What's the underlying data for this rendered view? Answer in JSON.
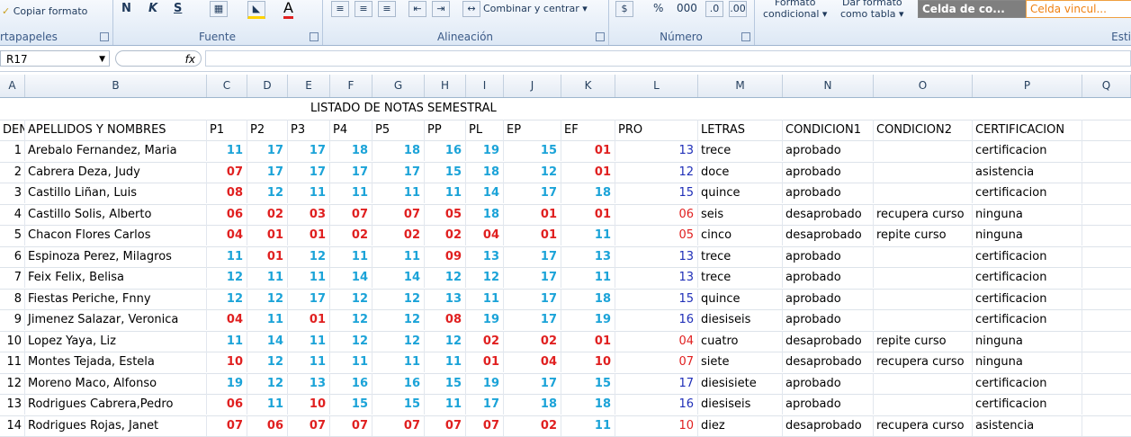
{
  "ribbon": {
    "copy_format": "Copiar formato",
    "groups": {
      "clipboard": "rtapapeles",
      "font": "Fuente",
      "alignment": "Alineación",
      "number": "Número",
      "styles": "Esti"
    },
    "font_buttons": {
      "bold": "N",
      "italic": "K",
      "underline": "S"
    },
    "merge_center": "Combinar y centrar",
    "number_buttons": {
      "percent": "%",
      "thousands": "000"
    },
    "conditional_format": [
      "Formato",
      "condicional"
    ],
    "table_format": [
      "Dar formato",
      "como tabla"
    ],
    "cell_style_1": "Celda de co...",
    "cell_style_2": "Celda vincul..."
  },
  "formula_bar": {
    "name_box": "R17",
    "fx": "fx",
    "value": ""
  },
  "column_headers": [
    "A",
    "B",
    "C",
    "D",
    "E",
    "F",
    "G",
    "H",
    "I",
    "J",
    "K",
    "L",
    "M",
    "N",
    "O",
    "P",
    "Q"
  ],
  "sheet": {
    "title": "LISTADO DE NOTAS SEMESTRAL",
    "headers": [
      "DEN",
      "APELLIDOS Y NOMBRES",
      "P1",
      "P2",
      "P3",
      "P4",
      "P5",
      "PP",
      "PL",
      "EP",
      "EF",
      "PRO",
      "LETRAS",
      "CONDICION1",
      "CONDICION2",
      "CERTIFICACION"
    ],
    "rows": [
      {
        "n": "1",
        "name": "Arebalo Fernandez, Maria",
        "g": [
          "11",
          "17",
          "17",
          "18",
          "18",
          "16",
          "19",
          "15",
          "01"
        ],
        "pro": "13",
        "letras": "trece",
        "c1": "aprobado",
        "c2": "",
        "cert": "certificacion"
      },
      {
        "n": "2",
        "name": "Cabrera Deza, Judy",
        "g": [
          "07",
          "17",
          "17",
          "17",
          "17",
          "15",
          "18",
          "12",
          "01"
        ],
        "pro": "12",
        "letras": "doce",
        "c1": "aprobado",
        "c2": "",
        "cert": "asistencia"
      },
      {
        "n": "3",
        "name": "Castillo Liñan, Luis",
        "g": [
          "08",
          "12",
          "11",
          "11",
          "11",
          "11",
          "14",
          "17",
          "18"
        ],
        "pro": "15",
        "letras": "quince",
        "c1": "aprobado",
        "c2": "",
        "cert": "certificacion"
      },
      {
        "n": "4",
        "name": "Castillo Solis, Alberto",
        "g": [
          "06",
          "02",
          "03",
          "07",
          "07",
          "05",
          "18",
          "01",
          "01"
        ],
        "pro": "06",
        "letras": "seis",
        "c1": "desaprobado",
        "c2": "recupera curso",
        "cert": "ninguna"
      },
      {
        "n": "5",
        "name": "Chacon Flores Carlos",
        "g": [
          "04",
          "01",
          "01",
          "02",
          "02",
          "02",
          "04",
          "01",
          "11"
        ],
        "pro": "05",
        "letras": "cinco",
        "c1": "desaprobado",
        "c2": "repite curso",
        "cert": "ninguna"
      },
      {
        "n": "6",
        "name": "Espinoza Perez, Milagros",
        "g": [
          "11",
          "01",
          "12",
          "11",
          "11",
          "09",
          "13",
          "17",
          "13"
        ],
        "pro": "13",
        "letras": "trece",
        "c1": "aprobado",
        "c2": "",
        "cert": "certificacion"
      },
      {
        "n": "7",
        "name": "Feix Felix, Belisa",
        "g": [
          "12",
          "11",
          "11",
          "14",
          "14",
          "12",
          "12",
          "17",
          "11"
        ],
        "pro": "13",
        "letras": "trece",
        "c1": "aprobado",
        "c2": "",
        "cert": "certificacion"
      },
      {
        "n": "8",
        "name": "Fiestas Periche, Fnny",
        "g": [
          "12",
          "12",
          "17",
          "12",
          "12",
          "13",
          "11",
          "17",
          "18"
        ],
        "pro": "15",
        "letras": "quince",
        "c1": "aprobado",
        "c2": "",
        "cert": "certificacion"
      },
      {
        "n": "9",
        "name": "Jimenez Salazar, Veronica",
        "g": [
          "04",
          "11",
          "01",
          "12",
          "12",
          "08",
          "19",
          "17",
          "19"
        ],
        "pro": "16",
        "letras": "diesiseis",
        "c1": "aprobado",
        "c2": "",
        "cert": "certificacion"
      },
      {
        "n": "10",
        "name": "Lopez Yaya, Liz",
        "g": [
          "11",
          "14",
          "11",
          "12",
          "12",
          "12",
          "02",
          "02",
          "01"
        ],
        "pro": "04",
        "letras": "cuatro",
        "c1": "desaprobado",
        "c2": "repite curso",
        "cert": "ninguna"
      },
      {
        "n": "11",
        "name": "Montes Tejada, Estela",
        "g": [
          "10",
          "12",
          "11",
          "11",
          "11",
          "11",
          "01",
          "04",
          "10"
        ],
        "pro": "07",
        "letras": "siete",
        "c1": "desaprobado",
        "c2": "recupera curso",
        "cert": "ninguna"
      },
      {
        "n": "12",
        "name": "Moreno Maco, Alfonso",
        "g": [
          "19",
          "12",
          "13",
          "16",
          "16",
          "15",
          "19",
          "17",
          "15"
        ],
        "pro": "17",
        "letras": "diesisiete",
        "c1": "aprobado",
        "c2": "",
        "cert": "certificacion"
      },
      {
        "n": "13",
        "name": "Rodrigues Cabrera,Pedro",
        "g": [
          "06",
          "11",
          "10",
          "15",
          "15",
          "11",
          "17",
          "18",
          "18"
        ],
        "pro": "16",
        "letras": "diesiseis",
        "c1": "aprobado",
        "c2": "",
        "cert": "certificacion"
      },
      {
        "n": "14",
        "name": "Rodrigues Rojas, Janet",
        "g": [
          "07",
          "06",
          "07",
          "07",
          "07",
          "07",
          "07",
          "02",
          "11"
        ],
        "pro": "10",
        "letras": "diez",
        "c1": "desaprobado",
        "c2": "recupera curso",
        "cert": "asistencia"
      }
    ]
  },
  "colors": {
    "pass": "#1ba3d8",
    "fail": "#e02020",
    "pro_pass": "#1f2fb8"
  }
}
